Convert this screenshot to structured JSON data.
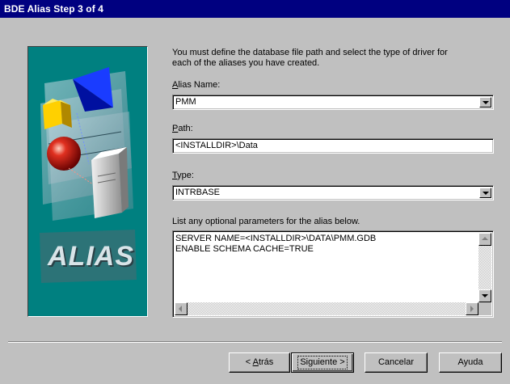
{
  "window": {
    "title": "BDE Alias Step 3 of 4"
  },
  "art": {
    "logo_text": "ALIAS"
  },
  "main": {
    "description_line1": "You must define the database file path and select the type of driver for",
    "description_line2": "each of the aliases you have created.",
    "alias_label_mnemonic": "A",
    "alias_label_rest": "lias Name:",
    "alias_value": "PMM",
    "path_label_mnemonic": "P",
    "path_label_rest": "ath:",
    "path_value": "<INSTALLDIR>\\Data",
    "type_label_mnemonic": "T",
    "type_label_rest": "ype:",
    "type_value": "INTRBASE",
    "params_label": "List any optional parameters for the alias below.",
    "params_lines": [
      "SERVER NAME=<INSTALLDIR>\\DATA\\PMM.GDB",
      "ENABLE SCHEMA CACHE=TRUE"
    ]
  },
  "buttons": {
    "back_prefix": "< ",
    "back_mnemonic": "A",
    "back_rest": "trás",
    "next_label": "Siguiente >",
    "cancel_label": "Cancelar",
    "help_label": "Ayuda"
  }
}
